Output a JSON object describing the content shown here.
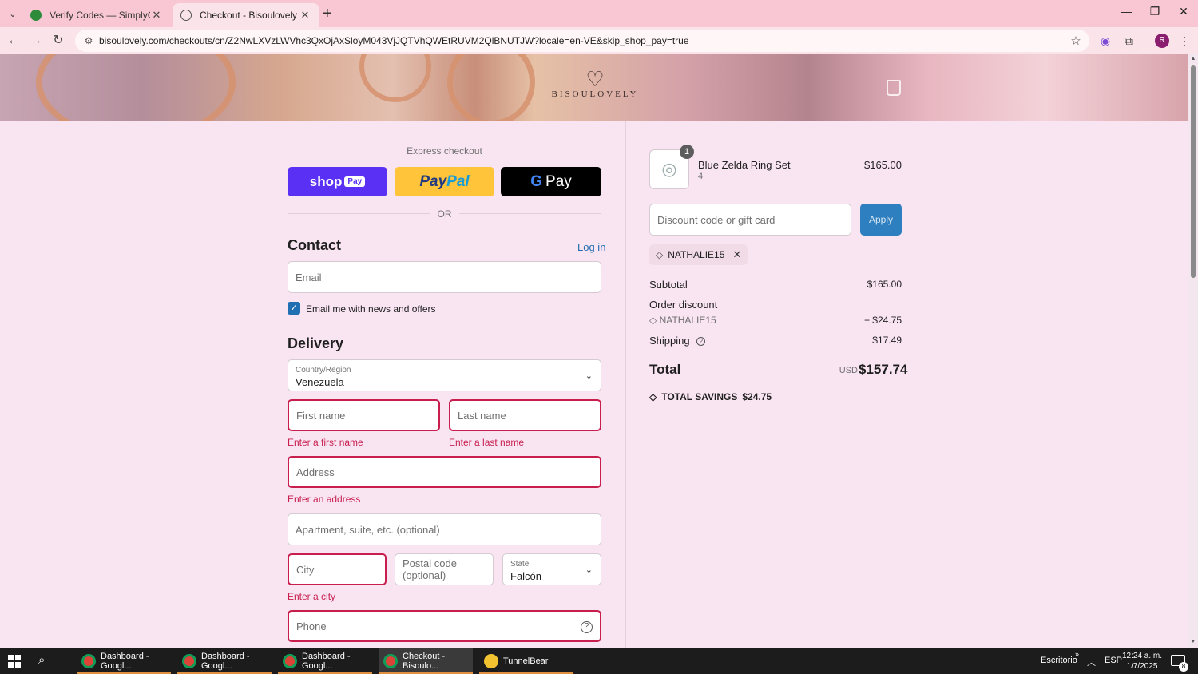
{
  "browser": {
    "tabs": [
      {
        "title": "Verify Codes — SimplyCodes",
        "favicon_color": "#2e8b3a"
      },
      {
        "title": "Checkout - Bisoulovely",
        "favicon_color": "#555555"
      }
    ],
    "url": "bisoulovely.com/checkouts/cn/Z2NwLXVzLWVhc3QxOjAxSloyM043VjJQTVhQWEtRUVM2QlBNUTJW?locale=en-VE&skip_shop_pay=true",
    "profile_initial": "R"
  },
  "header": {
    "brand": "BISOULOVELY"
  },
  "express": {
    "title": "Express checkout",
    "shop_label": "shop",
    "shop_pay_label": "Pay",
    "paypal_label_1": "Pay",
    "paypal_label_2": "Pal",
    "gpay_label": "Pay",
    "or_label": "OR"
  },
  "contact": {
    "heading": "Contact",
    "login_label": "Log in",
    "email_placeholder": "Email",
    "newsletter_label": "Email me with news and offers",
    "newsletter_checked": true
  },
  "delivery": {
    "heading": "Delivery",
    "country_label": "Country/Region",
    "country_value": "Venezuela",
    "first_name_placeholder": "First name",
    "first_name_error": "Enter a first name",
    "last_name_placeholder": "Last name",
    "last_name_error": "Enter a last name",
    "address_placeholder": "Address",
    "address_error": "Enter an address",
    "apartment_placeholder": "Apartment, suite, etc. (optional)",
    "city_placeholder": "City",
    "city_error": "Enter a city",
    "postal_placeholder": "Postal code (optional)",
    "state_label": "State",
    "state_value": "Falcón",
    "phone_placeholder": "Phone"
  },
  "summary": {
    "product": {
      "quantity": "1",
      "name": "Blue Zelda Ring Set",
      "variant": "4",
      "price": "$165.00"
    },
    "discount_placeholder": "Discount code or gift card",
    "apply_label": "Apply",
    "applied_code": "NATHALIE15",
    "subtotal_label": "Subtotal",
    "subtotal_value": "$165.00",
    "order_discount_label": "Order discount",
    "discount_code": "NATHALIE15",
    "discount_value": "− $24.75",
    "shipping_label": "Shipping",
    "shipping_value": "$17.49",
    "total_label": "Total",
    "total_currency": "USD",
    "total_value": "$157.74",
    "savings_label": "TOTAL SAVINGS",
    "savings_value": "$24.75"
  },
  "taskbar": {
    "apps": [
      {
        "label": "Dashboard - Googl...",
        "icon_color": "#db4437"
      },
      {
        "label": "Dashboard - Googl...",
        "icon_color": "#db4437"
      },
      {
        "label": "Dashboard - Googl...",
        "icon_color": "#db4437"
      },
      {
        "label": "Checkout - Bisoulo...",
        "icon_color": "#db4437"
      },
      {
        "label": "TunnelBear",
        "icon_color": "#f2c230"
      }
    ],
    "desktop_label": "Escritorio",
    "language": "ESP",
    "time": "12:24 a. m.",
    "date": "1/7/2025",
    "notification_count": "8"
  },
  "colors": {
    "accent": "#1f6fb2",
    "error": "#c81e4e",
    "shop_pay": "#5a31f4",
    "paypal": "#ffc439",
    "page_bg": "#f9e4f2"
  }
}
